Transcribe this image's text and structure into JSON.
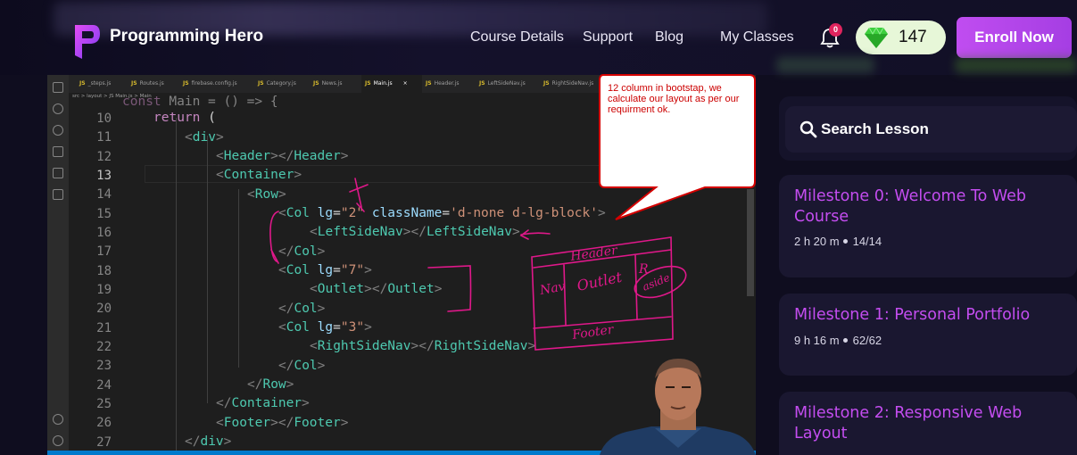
{
  "header": {
    "brand": "Programming Hero",
    "nav": [
      "Course Details",
      "Support",
      "Blog",
      "My Classes"
    ],
    "notification_count": "0",
    "gems": "147",
    "enroll_label": "Enroll Now"
  },
  "editor": {
    "tabs": [
      "_steps.js",
      "Routes.js",
      "firebase.config.js",
      "Category.js",
      "News.js",
      "Main.js",
      "Header.js",
      "LeftSideNav.js",
      "RightSideNav.js"
    ],
    "active_tab": "Main.js",
    "breadcrumb": "src > layout > JS Main.js > Main",
    "line_numbers": [
      "10",
      "11",
      "12",
      "13",
      "14",
      "15",
      "16",
      "17",
      "18",
      "19",
      "20",
      "21",
      "22",
      "23",
      "24",
      "25",
      "26",
      "27"
    ],
    "current_line": "13"
  },
  "annotation": {
    "bubble_text": "12 column in bootstap, we calculate our layout as per our requirment ok.",
    "sketch_labels": [
      "Header",
      "Nav",
      "Outlet",
      "R",
      "aside",
      "Footer"
    ]
  },
  "sidebar": {
    "search_label": "Search Lesson",
    "milestones": [
      {
        "title": "Milestone 0: Welcome To Web Course",
        "duration": "2 h 20 m",
        "progress": "14/14"
      },
      {
        "title": "Milestone 1: Personal Portfolio",
        "duration": "9 h 16 m",
        "progress": "62/62"
      },
      {
        "title": "Milestone 2: Responsive Web Layout",
        "duration": "",
        "progress": ""
      }
    ]
  },
  "colors": {
    "accent": "#c44df0",
    "enroll_button": "#b046e8",
    "gem_pill": "#e7f7d8",
    "editor_bg": "#1e1e1e"
  }
}
